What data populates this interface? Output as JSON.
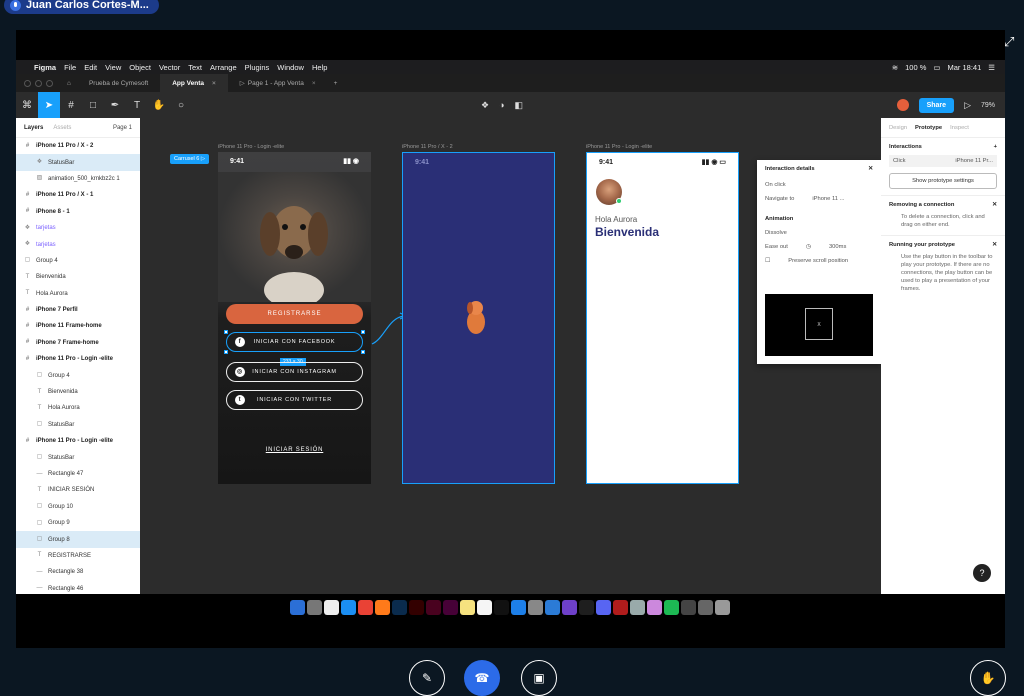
{
  "call": {
    "participant_name": "Juan Carlos Cortes-M..."
  },
  "menubar": {
    "items": [
      "Figma",
      "File",
      "Edit",
      "View",
      "Object",
      "Vector",
      "Text",
      "Arrange",
      "Plugins",
      "Window",
      "Help"
    ],
    "battery": "100 %",
    "datetime": "Mar 18:41"
  },
  "tabs": {
    "home": "Prueba de Cymesoft",
    "active": "App Venta",
    "third": "Page 1 - App Venta"
  },
  "toolbar": {
    "share_label": "Share",
    "zoom": "79%"
  },
  "layers_panel": {
    "tab_layers": "Layers",
    "tab_assets": "Assets",
    "page": "Page 1",
    "items": [
      {
        "label": "iPhone 11 Pro / X - 2",
        "style": "bold",
        "icon": "frame-icon"
      },
      {
        "label": "StatusBar",
        "style": "ind sel",
        "icon": "component-icon"
      },
      {
        "label": "animation_500_krnkbz2c 1",
        "style": "ind",
        "icon": "image-icon"
      },
      {
        "label": "iPhone 11 Pro / X - 1",
        "style": "bold",
        "icon": "frame-icon"
      },
      {
        "label": "iPhone 8 - 1",
        "style": "bold",
        "icon": "frame-icon"
      },
      {
        "label": "tarjetas",
        "style": "purple",
        "icon": "component-icon"
      },
      {
        "label": "tarjetas",
        "style": "purple",
        "icon": "component-icon"
      },
      {
        "label": "Group 4",
        "style": "",
        "icon": "group-icon"
      },
      {
        "label": "Bienvenida",
        "style": "",
        "icon": "text-icon"
      },
      {
        "label": "Hola Aurora",
        "style": "",
        "icon": "text-icon"
      },
      {
        "label": "iPhone 7 Perfil",
        "style": "bold",
        "icon": "frame-icon"
      },
      {
        "label": "iPhone 11 Frame-home",
        "style": "bold",
        "icon": "frame-icon"
      },
      {
        "label": "iPhone 7 Frame-home",
        "style": "bold",
        "icon": "frame-icon"
      },
      {
        "label": "iPhone 11 Pro - Login -elite",
        "style": "bold",
        "icon": "frame-icon"
      },
      {
        "label": "Group 4",
        "style": "ind",
        "icon": "group-icon"
      },
      {
        "label": "Bienvenida",
        "style": "ind",
        "icon": "text-icon"
      },
      {
        "label": "Hola Aurora",
        "style": "ind",
        "icon": "text-icon"
      },
      {
        "label": "StatusBar",
        "style": "ind",
        "icon": "group-icon"
      },
      {
        "label": "iPhone 11 Pro - Login -elite",
        "style": "bold",
        "icon": "frame-icon"
      },
      {
        "label": "StatusBar",
        "style": "ind",
        "icon": "group-icon"
      },
      {
        "label": "Rectangle 47",
        "style": "ind",
        "icon": "rect-icon"
      },
      {
        "label": "INICIAR SESIÓN",
        "style": "ind",
        "icon": "text-icon"
      },
      {
        "label": "Group 10",
        "style": "ind",
        "icon": "group-icon"
      },
      {
        "label": "Group 9",
        "style": "ind",
        "icon": "group-icon"
      },
      {
        "label": "Group 8",
        "style": "ind sel",
        "icon": "group-icon"
      },
      {
        "label": "REGISTRARSE",
        "style": "ind",
        "icon": "text-icon"
      },
      {
        "label": "Rectangle 38",
        "style": "ind",
        "icon": "rect-icon"
      },
      {
        "label": "Rectangle 46",
        "style": "ind",
        "icon": "rect-icon"
      }
    ]
  },
  "canvas": {
    "frame1_label": "iPhone 11 Pro - Login -elite",
    "frame2_label": "iPhone 11 Pro / X - 2",
    "frame3_label": "iPhone 11 Pro - Login -elite",
    "flow_start": "Carrusel 6",
    "status_time": "9:41",
    "btn_register": "REGISTRARSE",
    "btn_facebook": "INICIAR CON FACEBOOK",
    "btn_instagram": "INICIAR CON INSTAGRAM",
    "btn_twitter": "INICIAR CON TWITTER",
    "login_link": "INICIAR SESIÓN",
    "dimension": "233 × 30",
    "greeting": "Hola Aurora",
    "welcome": "Bienvenida"
  },
  "interaction_popover": {
    "title": "Interaction details",
    "trigger": "On click",
    "action": "Navigate to",
    "destination": "iPhone 11 ...",
    "animation_heading": "Animation",
    "animation": "Dissolve",
    "easing": "Ease out",
    "duration": "300ms",
    "preserve": "Preserve scroll position",
    "preview_letter": "X"
  },
  "right_panel": {
    "tab_design": "Design",
    "tab_prototype": "Prototype",
    "tab_inspect": "Inspect",
    "interactions_title": "Interactions",
    "click": "Click",
    "click_target": "iPhone 11 Pr...",
    "show_settings": "Show prototype settings",
    "removing_title": "Removing a connection",
    "removing_text": "To delete a connection, click and drag on either end.",
    "running_title": "Running your prototype",
    "running_text": "Use the play button in the toolbar to play your prototype. If there are no connections, the play button can be used to play a presentation of your frames.",
    "help": "?"
  }
}
